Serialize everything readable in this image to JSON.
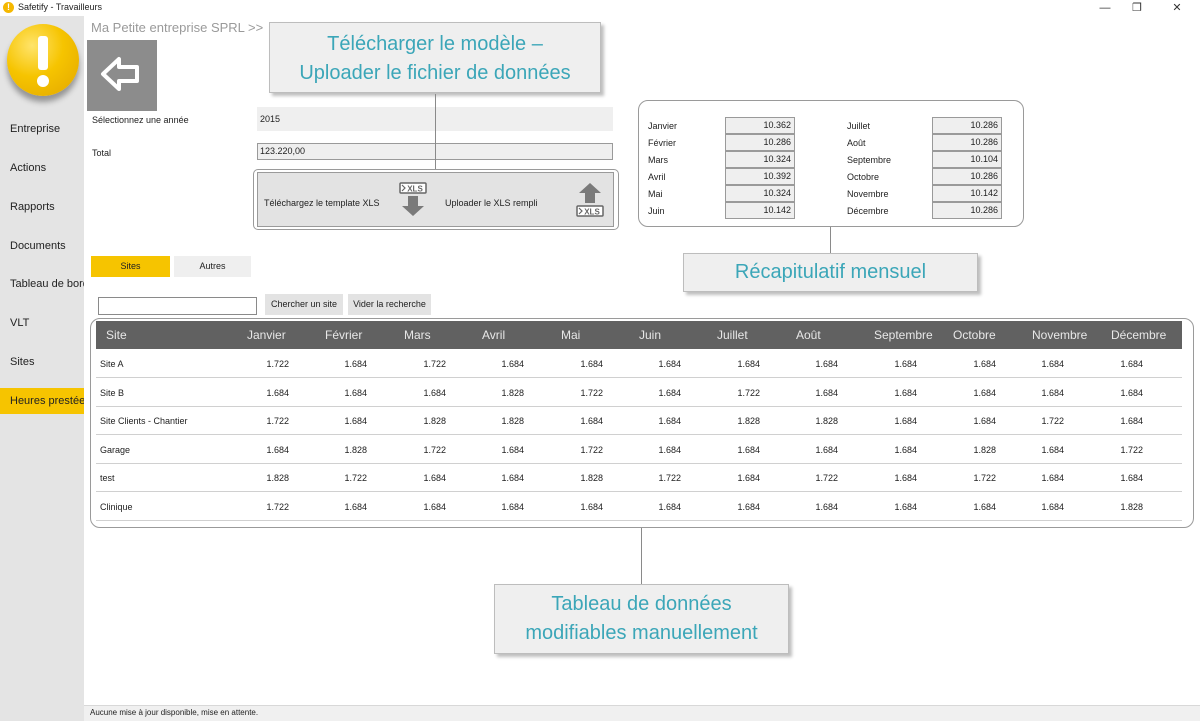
{
  "window": {
    "title": "Safetify - Travailleurs",
    "minimize": "—",
    "maximize": "❐",
    "close": "✕"
  },
  "sidebar": {
    "items": [
      {
        "label": "Entreprise",
        "active": false
      },
      {
        "label": "Actions",
        "active": false
      },
      {
        "label": "Rapports",
        "active": false
      },
      {
        "label": "Documents",
        "active": false
      },
      {
        "label": "Tableau de bord",
        "active": false
      },
      {
        "label": "VLT",
        "active": false
      },
      {
        "label": "Sites",
        "active": false
      },
      {
        "label": "Heures prestées",
        "active": true
      }
    ]
  },
  "breadcrumb": "Ma Petite entreprise SPRL >>",
  "form": {
    "year_label": "Sélectionnez une année",
    "year_value": "2015",
    "total_label": "Total",
    "total_value": "123.220,00"
  },
  "transfer": {
    "download_label": "Téléchargez le template XLS",
    "upload_label": "Uploader le XLS rempli",
    "xls_badge": "XLS"
  },
  "callouts": {
    "template": [
      "Télécharger le modèle –",
      "Uploader le fichier de données"
    ],
    "recap": "Récapitulatif mensuel",
    "table": [
      "Tableau de données",
      "modifiables manuellement"
    ]
  },
  "recap": {
    "left": [
      {
        "month": "Janvier",
        "value": "10.362"
      },
      {
        "month": "Février",
        "value": "10.286"
      },
      {
        "month": "Mars",
        "value": "10.324"
      },
      {
        "month": "Avril",
        "value": "10.392"
      },
      {
        "month": "Mai",
        "value": "10.324"
      },
      {
        "month": "Juin",
        "value": "10.142"
      }
    ],
    "right": [
      {
        "month": "Juillet",
        "value": "10.286"
      },
      {
        "month": "Août",
        "value": "10.286"
      },
      {
        "month": "Septembre",
        "value": "10.104"
      },
      {
        "month": "Octobre",
        "value": "10.286"
      },
      {
        "month": "Novembre",
        "value": "10.142"
      },
      {
        "month": "Décembre",
        "value": "10.286"
      }
    ]
  },
  "tabs": [
    {
      "label": "Sites",
      "active": true
    },
    {
      "label": "Autres",
      "active": false
    }
  ],
  "search": {
    "placeholder": "",
    "search_button": "Chercher un site",
    "clear_button": "Vider la recherche"
  },
  "table": {
    "columns": [
      "Site",
      "Janvier",
      "Février",
      "Mars",
      "Avril",
      "Mai",
      "Juin",
      "Juillet",
      "Août",
      "Septembre",
      "Octobre",
      "Novembre",
      "Décembre"
    ],
    "rows": [
      [
        "Site A",
        "1.722",
        "1.684",
        "1.722",
        "1.684",
        "1.684",
        "1.684",
        "1.684",
        "1.684",
        "1.684",
        "1.684",
        "1.684",
        "1.684"
      ],
      [
        "Site B",
        "1.684",
        "1.684",
        "1.684",
        "1.828",
        "1.722",
        "1.684",
        "1.722",
        "1.684",
        "1.684",
        "1.684",
        "1.684",
        "1.684"
      ],
      [
        "Site Clients - Chantier",
        "1.722",
        "1.684",
        "1.828",
        "1.828",
        "1.684",
        "1.684",
        "1.828",
        "1.828",
        "1.684",
        "1.684",
        "1.722",
        "1.684"
      ],
      [
        "Garage",
        "1.684",
        "1.828",
        "1.722",
        "1.684",
        "1.722",
        "1.684",
        "1.684",
        "1.684",
        "1.684",
        "1.828",
        "1.684",
        "1.722"
      ],
      [
        "test",
        "1.828",
        "1.722",
        "1.684",
        "1.684",
        "1.828",
        "1.722",
        "1.684",
        "1.722",
        "1.684",
        "1.722",
        "1.684",
        "1.684"
      ],
      [
        "Clinique",
        "1.722",
        "1.684",
        "1.684",
        "1.684",
        "1.684",
        "1.684",
        "1.684",
        "1.684",
        "1.684",
        "1.684",
        "1.684",
        "1.828"
      ]
    ]
  },
  "status": "Aucune mise à jour disponible, mise en attente.",
  "colors": {
    "accent": "#f6c400",
    "callout_text": "#3ba6b8",
    "header_bg": "#616161"
  }
}
